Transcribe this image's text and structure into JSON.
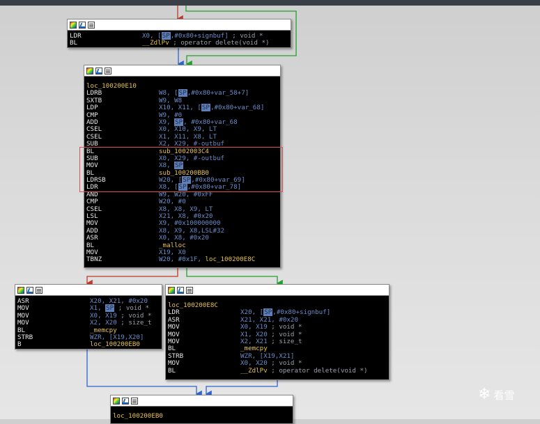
{
  "watermark": {
    "symbol": "❄",
    "text": "看雪"
  },
  "nodes": [
    {
      "id": "n0",
      "label": "",
      "lines": [
        {
          "mn": "LDR",
          "op": [
            {
              "t": "X0, ["
            },
            {
              "t": "SP",
              "cls": "sp"
            },
            {
              "t": ",#0x80+signbuf] "
            },
            {
              "t": "; void *",
              "cls": "cm"
            }
          ]
        },
        {
          "mn": "BL",
          "op": [
            {
              "t": "__ZdlPv ",
              "cls": "lbl"
            },
            {
              "t": "; operator delete(void *)",
              "cls": "cm"
            }
          ]
        }
      ]
    },
    {
      "id": "n1",
      "label": "loc_100200E10",
      "lines": [
        {
          "mn": "LDRB",
          "op": [
            {
              "t": "W8, ["
            },
            {
              "t": "SP",
              "cls": "sp"
            },
            {
              "t": ",#0x80+var_58+7]"
            }
          ]
        },
        {
          "mn": "SXTB",
          "op": [
            {
              "t": "W9, W8"
            }
          ]
        },
        {
          "mn": "LDP",
          "op": [
            {
              "t": "X10, X11, ["
            },
            {
              "t": "SP",
              "cls": "sp"
            },
            {
              "t": ",#0x80+var_68]"
            }
          ]
        },
        {
          "mn": "CMP",
          "op": [
            {
              "t": "W9, #0"
            }
          ]
        },
        {
          "mn": "ADD",
          "op": [
            {
              "t": "X9, "
            },
            {
              "t": "SP",
              "cls": "sp"
            },
            {
              "t": ", #0x80+var_68"
            }
          ]
        },
        {
          "mn": "CSEL",
          "op": [
            {
              "t": "X0, X10, X9, LT"
            }
          ]
        },
        {
          "mn": "CSEL",
          "op": [
            {
              "t": "X1, X11, X8, LT"
            }
          ]
        },
        {
          "mn": "SUB",
          "op": [
            {
              "t": "X2, X29, #-outbuf"
            }
          ]
        },
        {
          "mn": "BL",
          "op": [
            {
              "t": "sub_1002003C4",
              "cls": "lbl"
            }
          ]
        },
        {
          "mn": "SUB",
          "op": [
            {
              "t": "X0, X29, #-outbuf"
            }
          ]
        },
        {
          "mn": "MOV",
          "op": [
            {
              "t": "X8, "
            },
            {
              "t": "SP",
              "cls": "sp"
            }
          ]
        },
        {
          "mn": "BL",
          "op": [
            {
              "t": "sub_100200BB0",
              "cls": "lbl"
            }
          ]
        },
        {
          "mn": "LDRSB",
          "op": [
            {
              "t": "W20, ["
            },
            {
              "t": "SP",
              "cls": "sp"
            },
            {
              "t": ",#0x80+var_69]"
            }
          ]
        },
        {
          "mn": "LDR",
          "op": [
            {
              "t": "X8, ["
            },
            {
              "t": "SP",
              "cls": "sp"
            },
            {
              "t": ",#0x80+var_78]"
            }
          ]
        },
        {
          "mn": "AND",
          "op": [
            {
              "t": "W9, W20, #0xFF"
            }
          ]
        },
        {
          "mn": "CMP",
          "op": [
            {
              "t": "W20, #0"
            }
          ]
        },
        {
          "mn": "CSEL",
          "op": [
            {
              "t": "X8, X8, X9, LT"
            }
          ]
        },
        {
          "mn": "LSL",
          "op": [
            {
              "t": "X21, X8, #0x20"
            }
          ]
        },
        {
          "mn": "MOV",
          "op": [
            {
              "t": "X9, #0x100000000"
            }
          ]
        },
        {
          "mn": "ADD",
          "op": [
            {
              "t": "X8, X9, X8,LSL#32"
            }
          ]
        },
        {
          "mn": "ASR",
          "op": [
            {
              "t": "X0, X8, #0x20"
            }
          ]
        },
        {
          "mn": "BL",
          "op": [
            {
              "t": "_malloc",
              "cls": "lbl"
            }
          ]
        },
        {
          "mn": "MOV",
          "op": [
            {
              "t": "X19, X0"
            }
          ]
        },
        {
          "mn": "TBNZ",
          "op": [
            {
              "t": "W20, #0x1F, "
            },
            {
              "t": "loc_100200E8C",
              "cls": "lbl"
            }
          ]
        }
      ]
    },
    {
      "id": "n2",
      "label": "",
      "lines": [
        {
          "mn": "ASR",
          "op": [
            {
              "t": "X20, X21, #0x20"
            }
          ]
        },
        {
          "mn": "MOV",
          "op": [
            {
              "t": "X1, "
            },
            {
              "t": "SP",
              "cls": "sp"
            },
            {
              "t": " ; void *",
              "cls": "cm"
            }
          ]
        },
        {
          "mn": "MOV",
          "op": [
            {
              "t": "X0, X19 "
            },
            {
              "t": "; void *",
              "cls": "cm"
            }
          ]
        },
        {
          "mn": "MOV",
          "op": [
            {
              "t": "X2, X20 "
            },
            {
              "t": "; size_t",
              "cls": "cm"
            }
          ]
        },
        {
          "mn": "BL",
          "op": [
            {
              "t": "_memcpy",
              "cls": "lbl"
            }
          ]
        },
        {
          "mn": "STRB",
          "op": [
            {
              "t": "WZR, [X19,X20]"
            }
          ]
        },
        {
          "mn": "B",
          "op": [
            {
              "t": "loc_100200EB0",
              "cls": "lbl"
            }
          ]
        }
      ]
    },
    {
      "id": "n3",
      "label": "loc_100200E8C",
      "lines": [
        {
          "mn": "LDR",
          "op": [
            {
              "t": "X20, ["
            },
            {
              "t": "SP",
              "cls": "sp"
            },
            {
              "t": ",#0x80+signbuf]"
            }
          ]
        },
        {
          "mn": "ASR",
          "op": [
            {
              "t": "X21, X21, #0x20"
            }
          ]
        },
        {
          "mn": "MOV",
          "op": [
            {
              "t": "X0, X19 "
            },
            {
              "t": "; void *",
              "cls": "cm"
            }
          ]
        },
        {
          "mn": "MOV",
          "op": [
            {
              "t": "X1, X20 "
            },
            {
              "t": "; void *",
              "cls": "cm"
            }
          ]
        },
        {
          "mn": "MOV",
          "op": [
            {
              "t": "X2, X21 "
            },
            {
              "t": "; size_t",
              "cls": "cm"
            }
          ]
        },
        {
          "mn": "BL",
          "op": [
            {
              "t": "_memcpy",
              "cls": "lbl"
            }
          ]
        },
        {
          "mn": "STRB",
          "op": [
            {
              "t": "WZR, [X19,X21]"
            }
          ]
        },
        {
          "mn": "MOV",
          "op": [
            {
              "t": "X0, X20 "
            },
            {
              "t": "; void *",
              "cls": "cm"
            }
          ]
        },
        {
          "mn": "BL",
          "op": [
            {
              "t": "__ZdlPv ",
              "cls": "lbl"
            },
            {
              "t": "; operator delete(void *)",
              "cls": "cm"
            }
          ]
        }
      ]
    },
    {
      "id": "n4",
      "label": "loc_100200EB0",
      "lines": []
    }
  ]
}
